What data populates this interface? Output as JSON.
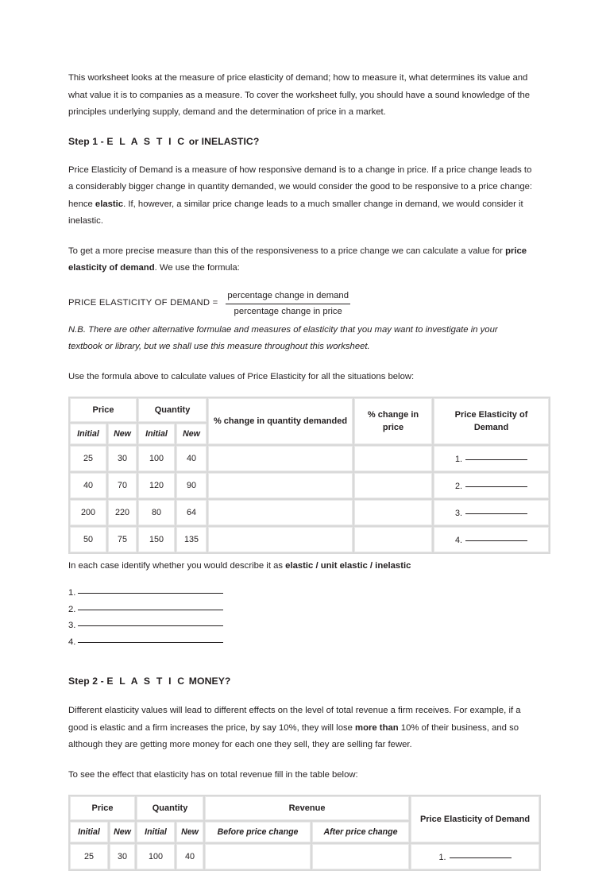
{
  "intro": {
    "paragraph": "This worksheet looks at the measure of price elasticity of demand; how to measure it, what determines its value and what value it is to companies as a measure. To cover the worksheet fully, you should have a sound knowledge of the principles underlying supply, demand and the determination of price in a market."
  },
  "step1": {
    "heading_prefix": "Step 1 - ",
    "heading_spaced": "E L A S T I C",
    "heading_suffix": " or INELASTIC?",
    "para1_a": "Price Elasticity of Demand is a measure of how responsive demand is to a change in price. If a price change leads to a considerably bigger change in quantity demanded, we would consider the good to be responsive to a price change: hence ",
    "para1_bold": "elastic",
    "para1_b": ". If, however, a similar price change leads to a much smaller change in demand, we would consider it inelastic.",
    "para2_a": "To get a more precise measure than this of the responsiveness to a price change we can calculate a value for ",
    "para2_bold": "price elasticity of demand",
    "para2_b": ". We use the formula:",
    "formula_lhs": "PRICE ELASTICITY OF DEMAND =",
    "formula_numerator": "percentage change in demand",
    "formula_denominator": "percentage change in price",
    "nb_note": "N.B. There are other alternative formulae and measures of elasticity that you may want to investigate in your textbook or library, but we shall use this measure throughout this worksheet.",
    "instruction": "Use the formula above to calculate values of Price Elasticity for all the situations below:",
    "identify_line_a": "In each case identify whether you would describe it as ",
    "identify_line_bold": "elastic / unit elastic / inelastic",
    "answer_numbers": [
      "1.",
      "2.",
      "3.",
      "4."
    ]
  },
  "table1": {
    "headers_top": [
      "Price",
      "Quantity",
      "% change in quantity demanded",
      "% change in price",
      "Price Elasticity of Demand"
    ],
    "headers_sub": [
      "Initial",
      "New",
      "Initial",
      "New"
    ],
    "rows": [
      {
        "price_initial": "25",
        "price_new": "30",
        "qty_initial": "100",
        "qty_new": "40",
        "pct_qty": "",
        "pct_price": "",
        "ped_label": "1."
      },
      {
        "price_initial": "40",
        "price_new": "70",
        "qty_initial": "120",
        "qty_new": "90",
        "pct_qty": "",
        "pct_price": "",
        "ped_label": "2."
      },
      {
        "price_initial": "200",
        "price_new": "220",
        "qty_initial": "80",
        "qty_new": "64",
        "pct_qty": "",
        "pct_price": "",
        "ped_label": "3."
      },
      {
        "price_initial": "50",
        "price_new": "75",
        "qty_initial": "150",
        "qty_new": "135",
        "pct_qty": "",
        "pct_price": "",
        "ped_label": "4."
      }
    ]
  },
  "step2": {
    "heading_prefix": "Step 2 - ",
    "heading_spaced": "E L A S T I C",
    "heading_suffix": " MONEY?",
    "para1_a": "Different elasticity values will lead to different effects on the level of total revenue a firm receives. For example, if a good is elastic and a firm increases the price, by say 10%, they will lose ",
    "para1_bold": "more than",
    "para1_b": " 10% of their business, and so although they are getting more money for each one they sell, they are selling far fewer.",
    "instruction": "To see the effect that elasticity has on total revenue fill in the table below:"
  },
  "table2": {
    "headers_top": [
      "Price",
      "Quantity",
      "Revenue",
      "Price Elasticity of Demand"
    ],
    "headers_sub": [
      "Initial",
      "New",
      "Initial",
      "New",
      "Before price change",
      "After price change"
    ],
    "rows": [
      {
        "price_initial": "25",
        "price_new": "30",
        "qty_initial": "100",
        "qty_new": "40",
        "rev_before": "",
        "rev_after": "",
        "ped_label": "1."
      }
    ]
  }
}
